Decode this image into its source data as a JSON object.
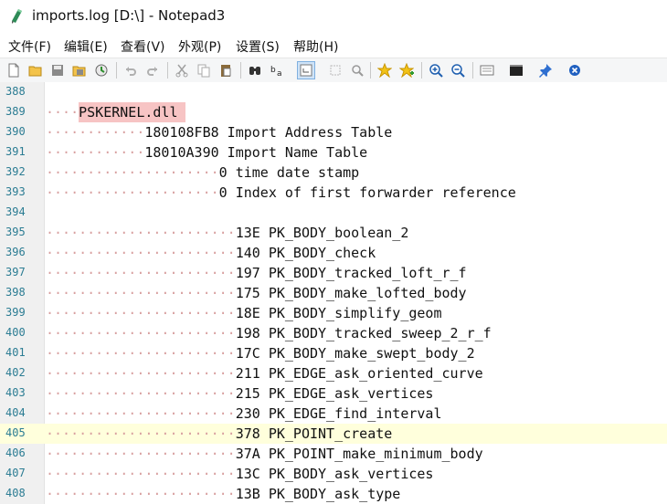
{
  "window": {
    "title": "imports.log [D:\\] - Notepad3"
  },
  "menu": [
    "文件(F)",
    "编辑(E)",
    "查看(V)",
    "外观(P)",
    "设置(S)",
    "帮助(H)"
  ],
  "toolbar_icons": [
    "new-file-icon",
    "open-folder-icon",
    "save-icon",
    "save-as-icon",
    "reload-icon",
    "undo-icon",
    "redo-icon",
    "cut-icon",
    "copy-icon",
    "paste-icon",
    "find-icon",
    "replace-icon",
    "word-wrap-icon",
    "select-icon",
    "zoom-find-icon",
    "bookmark-star-icon",
    "add-bookmark-icon",
    "zoom-in-icon",
    "zoom-out-icon",
    "settings-icon",
    "terminal-icon",
    "pin-icon",
    "close-icon"
  ],
  "editor": {
    "current_line": "405",
    "highlight_text": "PSKERNEL.dll",
    "lines": [
      {
        "n": "388",
        "ws": "",
        "text": ""
      },
      {
        "n": "389",
        "ws": "····",
        "text": "PSKERNEL.dll",
        "hl": true
      },
      {
        "n": "390",
        "ws": "············",
        "text": "180108FB8 Import Address Table"
      },
      {
        "n": "391",
        "ws": "············",
        "text": "18010A390 Import Name Table"
      },
      {
        "n": "392",
        "ws": "·····················",
        "text": "0 time date stamp"
      },
      {
        "n": "393",
        "ws": "·····················",
        "text": "0 Index of first forwarder reference"
      },
      {
        "n": "394",
        "ws": "",
        "text": ""
      },
      {
        "n": "395",
        "ws": "·······················",
        "text": "13E PK_BODY_boolean_2"
      },
      {
        "n": "396",
        "ws": "·······················",
        "text": "140 PK_BODY_check"
      },
      {
        "n": "397",
        "ws": "·······················",
        "text": "197 PK_BODY_tracked_loft_r_f"
      },
      {
        "n": "398",
        "ws": "·······················",
        "text": "175 PK_BODY_make_lofted_body"
      },
      {
        "n": "399",
        "ws": "·······················",
        "text": "18E PK_BODY_simplify_geom"
      },
      {
        "n": "400",
        "ws": "·······················",
        "text": "198 PK_BODY_tracked_sweep_2_r_f"
      },
      {
        "n": "401",
        "ws": "·······················",
        "text": "17C PK_BODY_make_swept_body_2"
      },
      {
        "n": "402",
        "ws": "·······················",
        "text": "211 PK_EDGE_ask_oriented_curve"
      },
      {
        "n": "403",
        "ws": "·······················",
        "text": "215 PK_EDGE_ask_vertices"
      },
      {
        "n": "404",
        "ws": "·······················",
        "text": "230 PK_EDGE_find_interval"
      },
      {
        "n": "405",
        "ws": "·······················",
        "text": "378 PK_POINT_create"
      },
      {
        "n": "406",
        "ws": "·······················",
        "text": "37A PK_POINT_make_minimum_body"
      },
      {
        "n": "407",
        "ws": "·······················",
        "text": "13C PK_BODY_ask_vertices"
      },
      {
        "n": "408",
        "ws": "·······················",
        "text": "13B PK_BODY_ask_type"
      }
    ]
  }
}
